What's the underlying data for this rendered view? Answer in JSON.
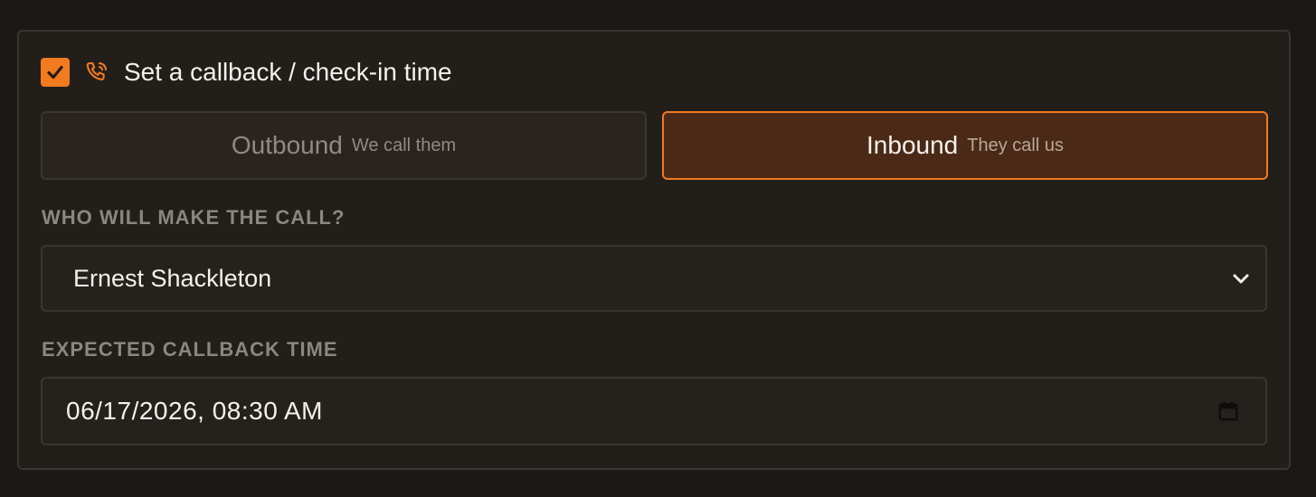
{
  "callback": {
    "enabled": true,
    "title": "Set a callback / check-in time",
    "icons": {
      "checkbox": "check-icon",
      "phone": "phone-callback-icon"
    }
  },
  "direction": {
    "outbound": {
      "label": "Outbound",
      "sublabel": "We call them",
      "selected": false
    },
    "inbound": {
      "label": "Inbound",
      "sublabel": "They call us",
      "selected": true
    }
  },
  "caller": {
    "label": "WHO WILL MAKE THE CALL?",
    "selected": "Ernest Shackleton",
    "icon": "chevron-down-icon"
  },
  "callback_time": {
    "label": "EXPECTED CALLBACK TIME",
    "value": "06/17/2026, 08:30 AM",
    "icon": "calendar-icon"
  },
  "colors": {
    "accent": "#f27a1f",
    "selected_bg": "#4a2a16",
    "panel_bg": "#221e1a",
    "page_bg": "#1b1815"
  }
}
